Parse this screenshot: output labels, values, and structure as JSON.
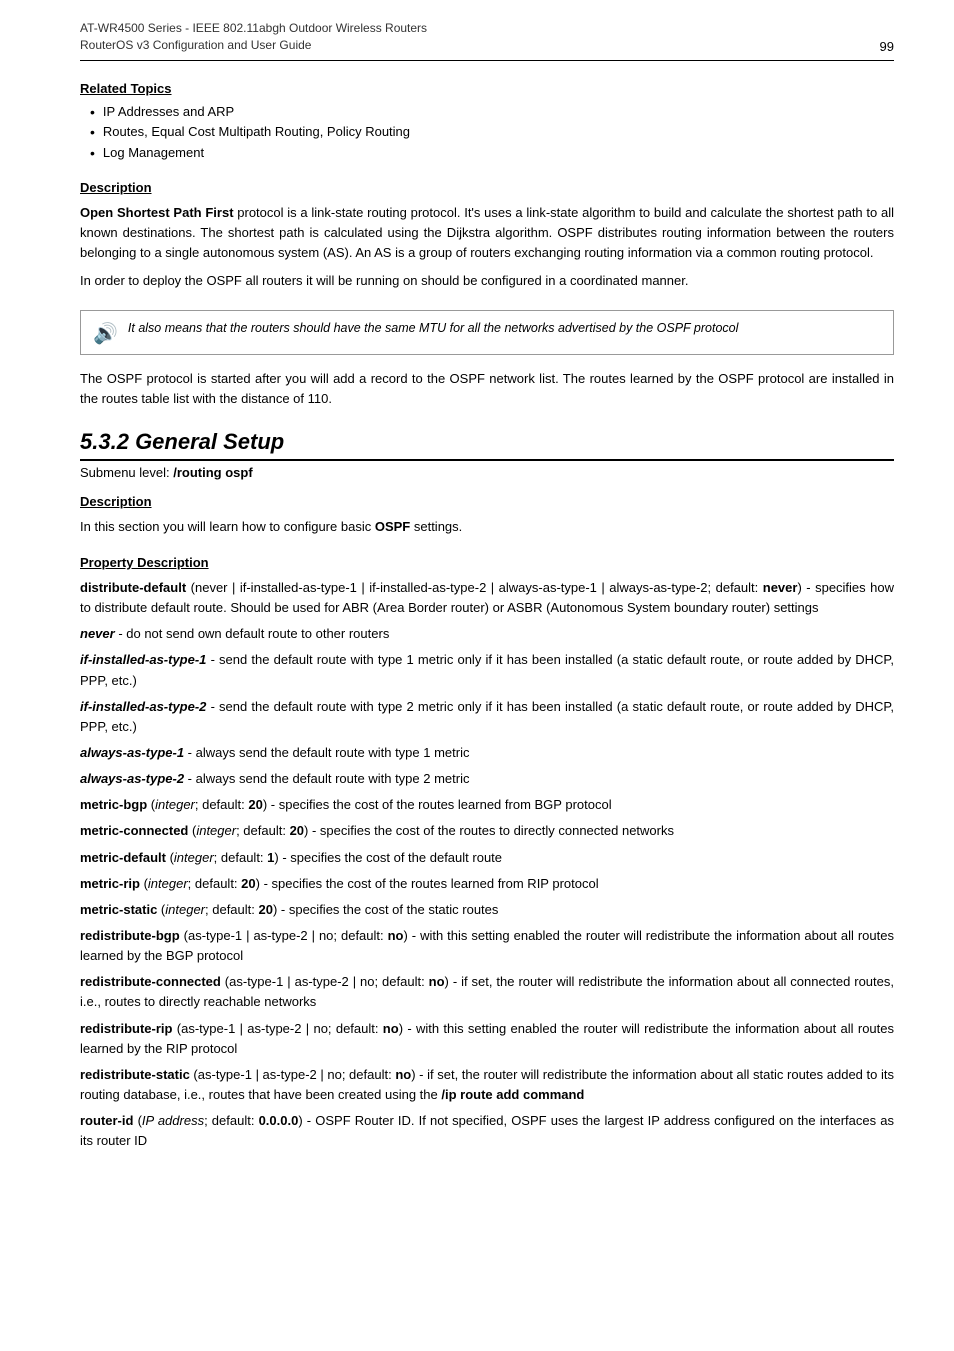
{
  "header": {
    "left_line1": "AT-WR4500 Series - IEEE 802.11abgh Outdoor Wireless Routers",
    "left_line2": "RouterOS v3 Configuration and User Guide",
    "page_number": "99"
  },
  "related_topics": {
    "heading": "Related Topics",
    "items": [
      "IP Addresses and ARP",
      "Routes, Equal Cost Multipath Routing, Policy Routing",
      "Log Management"
    ]
  },
  "description_section": {
    "heading": "Description",
    "paragraphs": [
      "Open Shortest Path First protocol is a link-state routing protocol. It's uses a link-state algorithm to build and calculate the shortest path to all known destinations. The shortest path is calculated using the Dijkstra algorithm. OSPF distributes routing information between the routers belonging to a single autonomous system (AS). An AS is a group of routers exchanging routing information via a common routing protocol.",
      "In order to deploy the OSPF all routers it will be running on should be configured in a coordinated manner."
    ]
  },
  "note": {
    "icon": "🔊",
    "text": "It also means that the routers should have the same MTU for all the networks advertised by the OSPF protocol"
  },
  "ospf_note": "The OSPF protocol is started after you will add a record to the OSPF network list. The routes learned by the OSPF protocol are installed in the routes table list with the distance of 110.",
  "chapter": {
    "number": "5.3.2",
    "title": "General Setup",
    "submenu": "Submenu level: /routing ospf"
  },
  "chapter_description": {
    "heading": "Description",
    "text": "In this section you will learn how to configure basic OSPF settings."
  },
  "property_description": {
    "heading": "Property Description",
    "properties": [
      {
        "name": "distribute-default",
        "text": " (never | if-installed-as-type-1 | if-installed-as-type-2 | always-as-type-1 | always-as-type-2; default: ",
        "default_bold": "never",
        "after_default": ") - specifies how to distribute default route. Should be used for ABR (Area Border router) or ASBR (Autonomous System boundary router) settings"
      }
    ],
    "never_desc": "never - do not send own default route to other routers",
    "if_type1": "if-installed-as-type-1 - send the default route with type 1 metric only if it has been installed (a static default route, or route added by DHCP, PPP, etc.)",
    "if_type2": "if-installed-as-type-2 - send the default route with type 2 metric only if it has been installed (a static default route, or route added by DHCP, PPP, etc.)",
    "always_type1": "always-as-type-1 - always send the default route with type 1 metric",
    "always_type2": "always-as-type-2 - always send the default route with type 2 metric",
    "metric_bgp": "metric-bgp (integer; default: 20) - specifies the cost of the routes learned from BGP protocol",
    "metric_connected": "metric-connected (integer; default: 20) - specifies the cost of the routes to directly connected networks",
    "metric_default": "metric-default (integer; default: 1) - specifies the cost of the default route",
    "metric_rip": "metric-rip (integer; default: 20) - specifies the cost of the routes learned from RIP protocol",
    "metric_static": "metric-static (integer; default: 20) - specifies the cost of the static routes",
    "redistribute_bgp": "redistribute-bgp (as-type-1 | as-type-2 | no; default: no) - with this setting enabled the router will redistribute the information about all routes learned by the BGP protocol",
    "redistribute_connected": "redistribute-connected (as-type-1 | as-type-2 | no; default: no) - if set, the router will redistribute the information about all connected routes, i.e., routes to directly reachable networks",
    "redistribute_rip": "redistribute-rip (as-type-1 | as-type-2 | no; default: no) - with this setting enabled the router will redistribute the information about all routes learned by the RIP protocol",
    "redistribute_static": "redistribute-static (as-type-1 | as-type-2 | no; default: no) - if set, the router will redistribute the information about all static routes added to its routing database, i.e., routes that have been created using the /ip route add command",
    "router_id": "router-id (IP address; default: 0.0.0.0) - OSPF Router ID. If not specified, OSPF uses the largest IP address configured on the interfaces as its router ID"
  }
}
